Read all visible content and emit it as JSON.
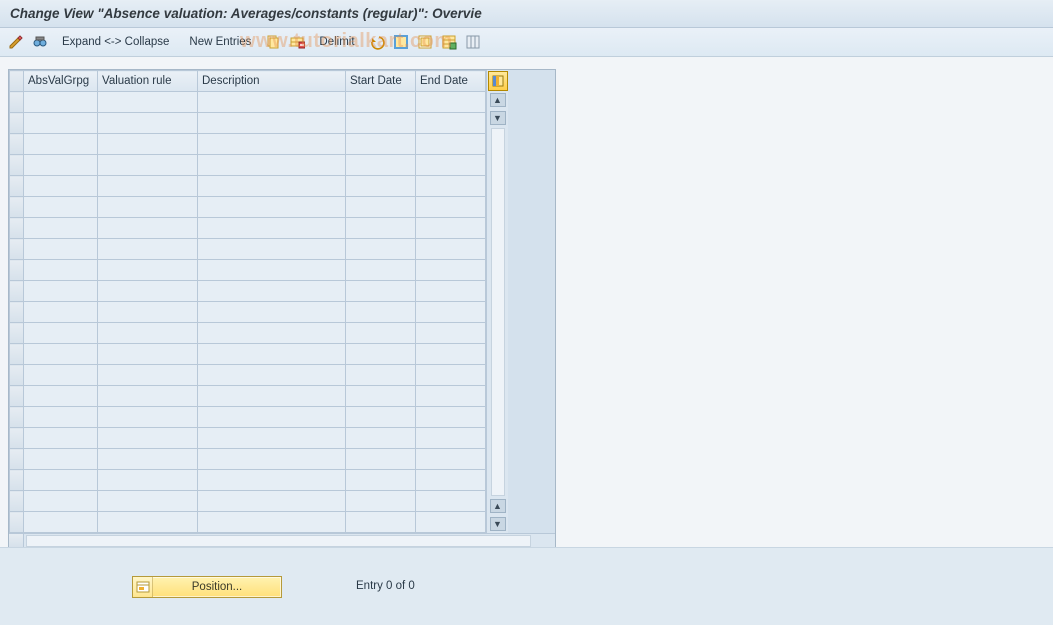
{
  "title": "Change View \"Absence valuation: Averages/constants (regular)\": Overvie",
  "toolbar": {
    "expand_collapse": "Expand <-> Collapse",
    "new_entries": "New Entries",
    "delimit": "Delimit"
  },
  "watermark": "www.tutorialkart.com",
  "table": {
    "columns": {
      "absvalgrpg": "AbsValGrpg",
      "valuation_rule": "Valuation rule",
      "description": "Description",
      "start_date": "Start Date",
      "end_date": "End Date"
    },
    "row_count": 21,
    "rows": []
  },
  "footer": {
    "position_button": "Position...",
    "entry_text": "Entry 0 of 0"
  }
}
